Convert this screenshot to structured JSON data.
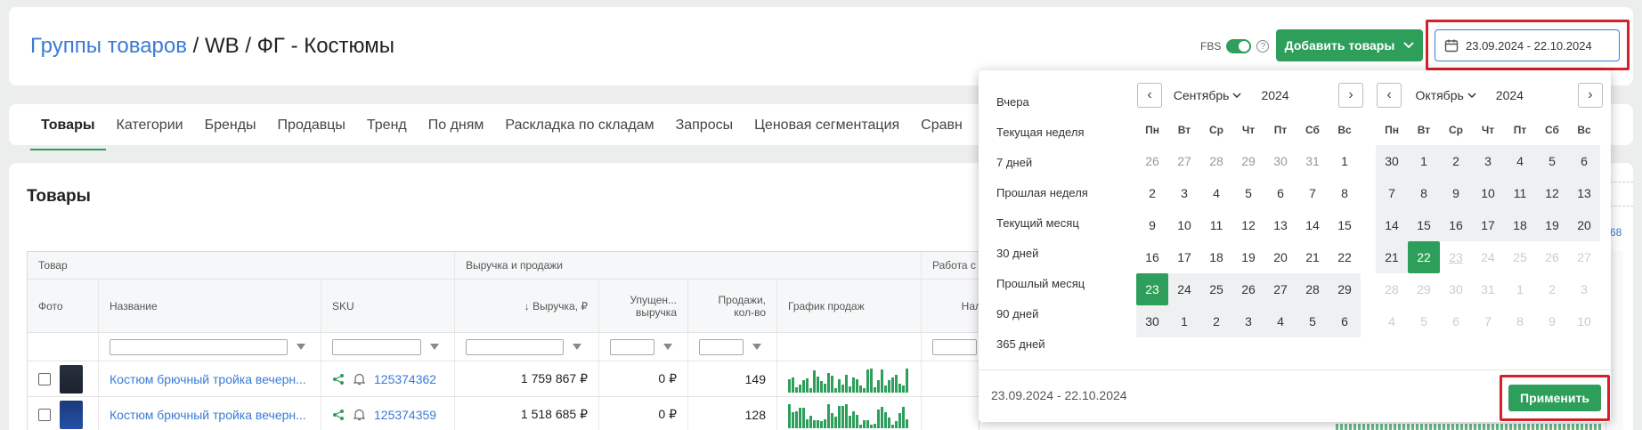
{
  "header": {
    "breadcrumb_link": "Группы товаров",
    "breadcrumb_rest": " / WB / ФГ - Костюмы",
    "fbs_label": "FBS",
    "add_button": "Добавить товары",
    "date_range": "23.09.2024 - 22.10.2024"
  },
  "tabs": [
    "Товары",
    "Категории",
    "Бренды",
    "Продавцы",
    "Тренд",
    "По дням",
    "Раскладка по складам",
    "Запросы",
    "Ценовая сегментация",
    "Сравн"
  ],
  "products": {
    "title": "Товары",
    "groups": {
      "product": "Товар",
      "sales": "Выручка и продажи",
      "work": "Работа с"
    },
    "columns": {
      "photo": "Фото",
      "name": "Название",
      "sku": "SKU",
      "revenue": "↓ Выручка, ₽",
      "lost": "Упущен... выручка",
      "sales": "Продажи, кол-во",
      "chart": "График продаж",
      "extra": "Нал"
    },
    "rows": [
      {
        "name": "Костюм брючный тройка вечерн...",
        "sku": "125374362",
        "revenue": "1 759 867 ₽",
        "lost": "0 ₽",
        "sales": "149"
      },
      {
        "name": "Костюм брючный тройка вечерн...",
        "sku": "125374359",
        "revenue": "1 518 685 ₽",
        "lost": "0 ₽",
        "sales": "128"
      }
    ]
  },
  "datepicker": {
    "presets": [
      "Вчера",
      "Текущая неделя",
      "7 дней",
      "Прошлая неделя",
      "Текущий месяц",
      "30 дней",
      "Прошлый месяц",
      "90 дней",
      "365 дней"
    ],
    "weekdays": [
      "Пн",
      "Вт",
      "Ср",
      "Чт",
      "Пт",
      "Сб",
      "Вс"
    ],
    "left": {
      "month": "Сентябрь",
      "year": "2024"
    },
    "right": {
      "month": "Октябрь",
      "year": "2024"
    },
    "footer_range": "23.09.2024 - 22.10.2024",
    "apply": "Применить"
  },
  "colors": {
    "accent": "#2e9e5b",
    "link": "#3a7bd5",
    "highlight": "#d6212a"
  }
}
